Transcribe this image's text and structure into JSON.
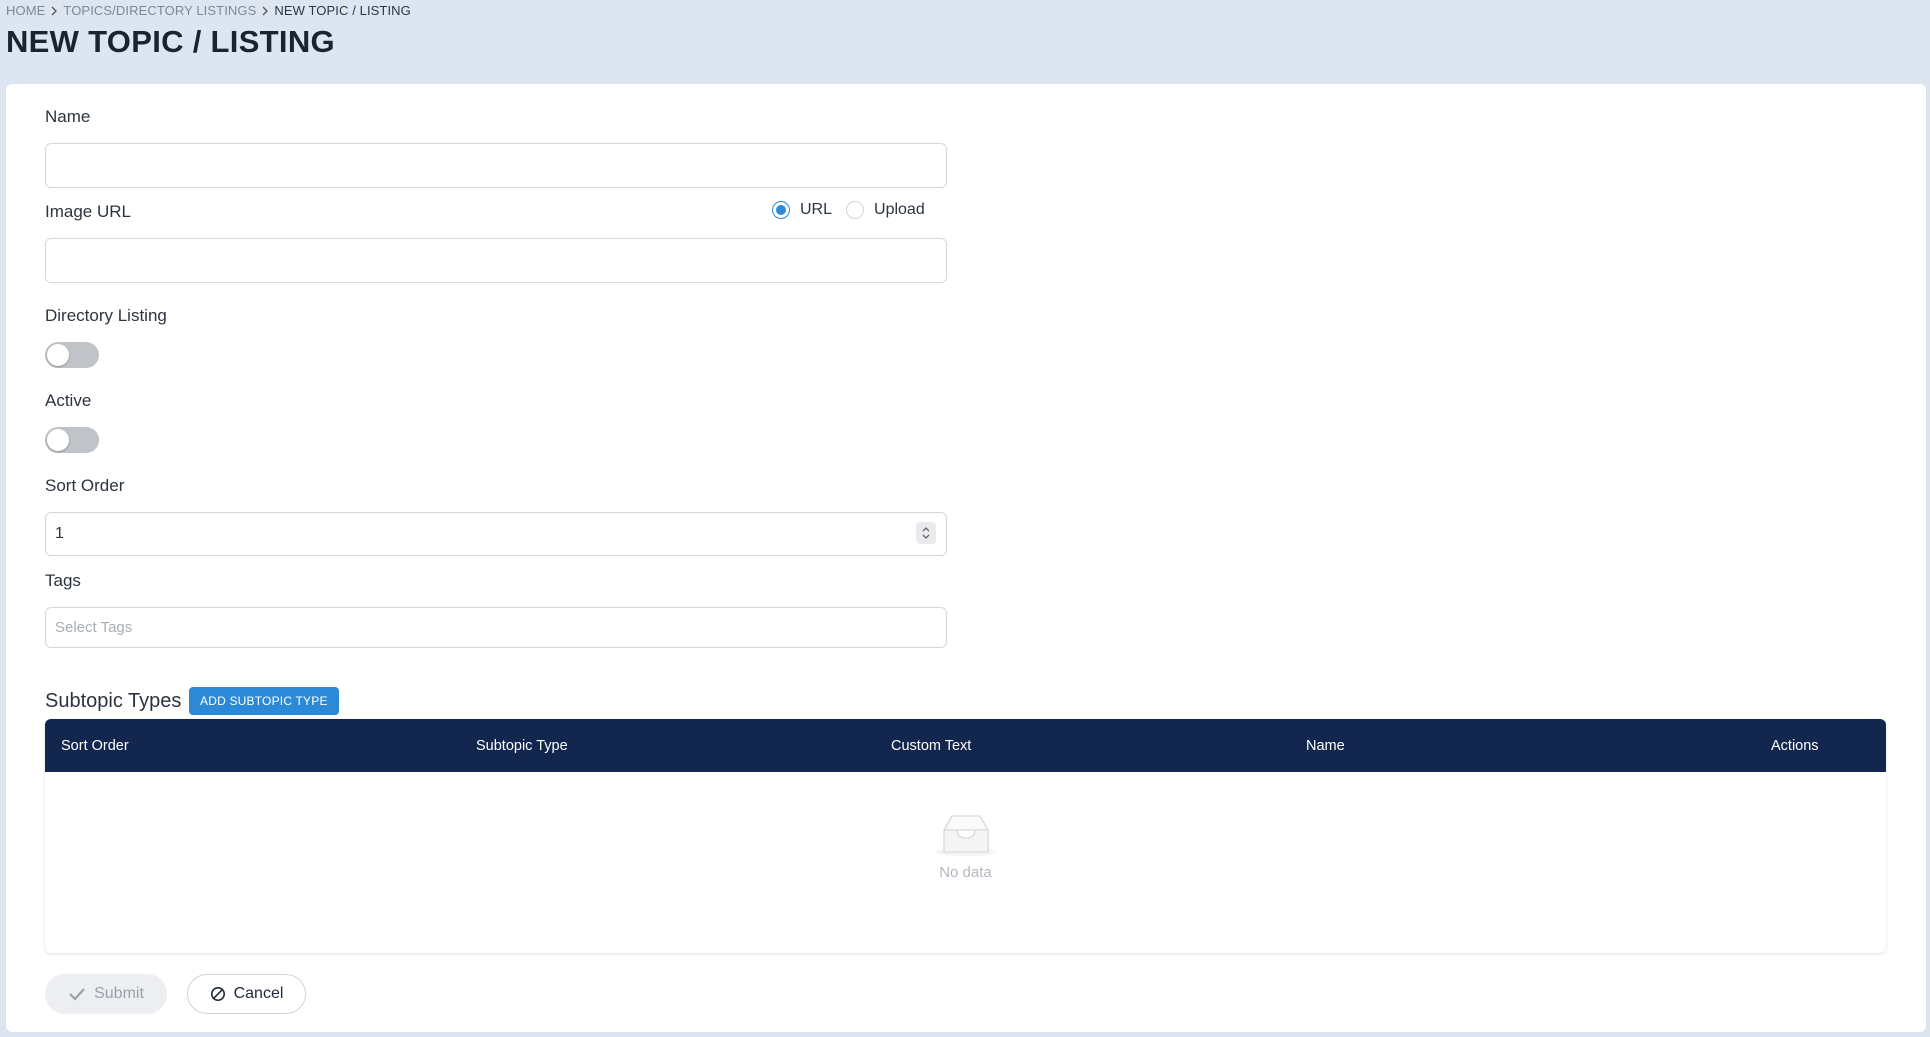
{
  "breadcrumb": {
    "items": [
      "HOME",
      "TOPICS/DIRECTORY LISTINGS",
      "NEW TOPIC / LISTING"
    ]
  },
  "page": {
    "title": "NEW TOPIC / LISTING"
  },
  "form": {
    "name": {
      "label": "Name",
      "value": ""
    },
    "image_url": {
      "label": "Image URL",
      "value": "",
      "mode_options": [
        "URL",
        "Upload"
      ],
      "selected_mode": "URL"
    },
    "directory_listing": {
      "label": "Directory Listing",
      "enabled": false
    },
    "active": {
      "label": "Active",
      "enabled": false
    },
    "sort_order": {
      "label": "Sort Order",
      "value": "1"
    },
    "tags": {
      "label": "Tags",
      "placeholder": "Select Tags"
    }
  },
  "subtopics": {
    "title": "Subtopic Types",
    "add_button": "ADD SUBTOPIC TYPE",
    "columns": [
      "Sort Order",
      "Subtopic Type",
      "Custom Text",
      "Name",
      "Actions"
    ],
    "rows": [],
    "empty_text": "No data"
  },
  "actions": {
    "submit": "Submit",
    "cancel": "Cancel"
  },
  "colors": {
    "primary": "#2b89d7",
    "table_header": "#13264d",
    "background": "#dde6f0"
  }
}
